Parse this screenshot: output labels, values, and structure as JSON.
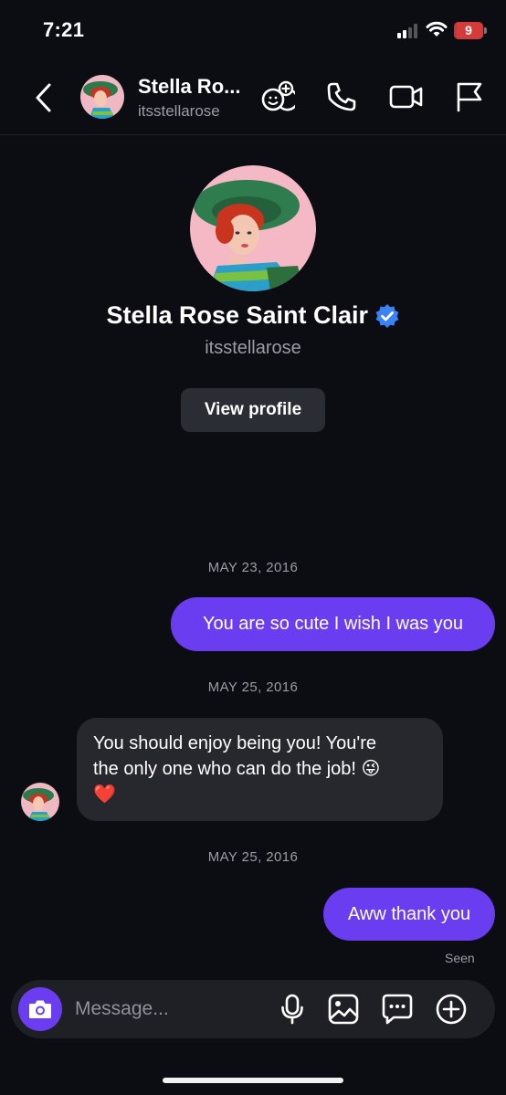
{
  "status_bar": {
    "time": "7:21",
    "battery": "9",
    "battery_level_percent": 9
  },
  "header": {
    "name": "Stella Ro...",
    "handle": "itsstellarose"
  },
  "profile": {
    "name": "Stella Rose Saint Clair",
    "handle": "itsstellarose",
    "view_profile_label": "View profile",
    "verified": true
  },
  "messages": [
    {
      "date": "MAY 23, 2016",
      "direction": "outgoing",
      "text": "You are so cute I wish I was you"
    },
    {
      "date": "MAY 25, 2016",
      "direction": "incoming",
      "line1": "You should enjoy being you! You're",
      "line2": "the only one who can do the job! 😜",
      "line3": "❤️"
    },
    {
      "date": "MAY 25, 2016",
      "direction": "outgoing",
      "text": "Aww thank you",
      "status": "Seen"
    }
  ],
  "composer": {
    "placeholder": "Message..."
  },
  "colors": {
    "accent": "#6a3df0",
    "background": "#0b0d12",
    "incoming_bubble": "#26282e",
    "verified": "#3b82f6",
    "battery": "#d63b3b"
  },
  "icons": [
    "back-chevron-icon",
    "add-friends-icon",
    "phone-icon",
    "video-icon",
    "flag-icon",
    "verified-badge-icon",
    "camera-icon",
    "microphone-icon",
    "image-icon",
    "sticker-message-icon",
    "plus-circle-icon"
  ]
}
